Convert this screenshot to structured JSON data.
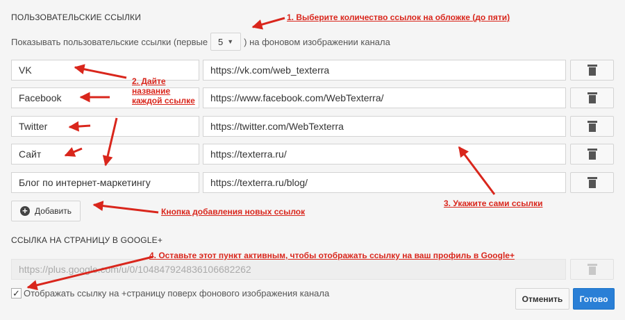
{
  "links_section": {
    "title": "ПОЛЬЗОВАТЕЛЬСКИЕ ССЫЛКИ",
    "show_prefix": "Показывать пользовательские ссылки (первые",
    "show_count": "5",
    "show_suffix": ") на фоновом изображении канала"
  },
  "links": [
    {
      "name": "VK",
      "url": "https://vk.com/web_texterra"
    },
    {
      "name": "Facebook",
      "url": "https://www.facebook.com/WebTexterra/"
    },
    {
      "name": "Twitter",
      "url": "https://twitter.com/WebTexterra"
    },
    {
      "name": "Сайт",
      "url": "https://texterra.ru/"
    },
    {
      "name": "Блог по интернет-маркетингу",
      "url": "https://texterra.ru/blog/"
    }
  ],
  "add_button_label": "Добавить",
  "gplus_section": {
    "title": "ССЫЛКА НА СТРАНИЦУ В GOOGLE+",
    "url": "https://plus.google.com/u/0/104847924836106682262",
    "checkbox_label": "Отображать ссылку на +страницу поверх фонового изображения канала",
    "checked": true
  },
  "footer": {
    "cancel_label": "Отменить",
    "done_label": "Готово"
  },
  "annotations": {
    "step1": "1. Выберите количество ссылок на обложке (до пяти)",
    "step2_line1": "2. Дайте",
    "step2_line2": "название",
    "step2_line3": "каждой ссылке",
    "step3": "3. Укажите сами ссылки",
    "add_note": "Кнопка добавления новых ссылок",
    "step4": "4. Оставьте этот пункт активным, чтобы отображать ссылку на ваш профиль в Google+"
  },
  "colors": {
    "annotation_red": "#d9261c",
    "primary_blue": "#2a7fd6",
    "background": "#f5f5f5"
  }
}
